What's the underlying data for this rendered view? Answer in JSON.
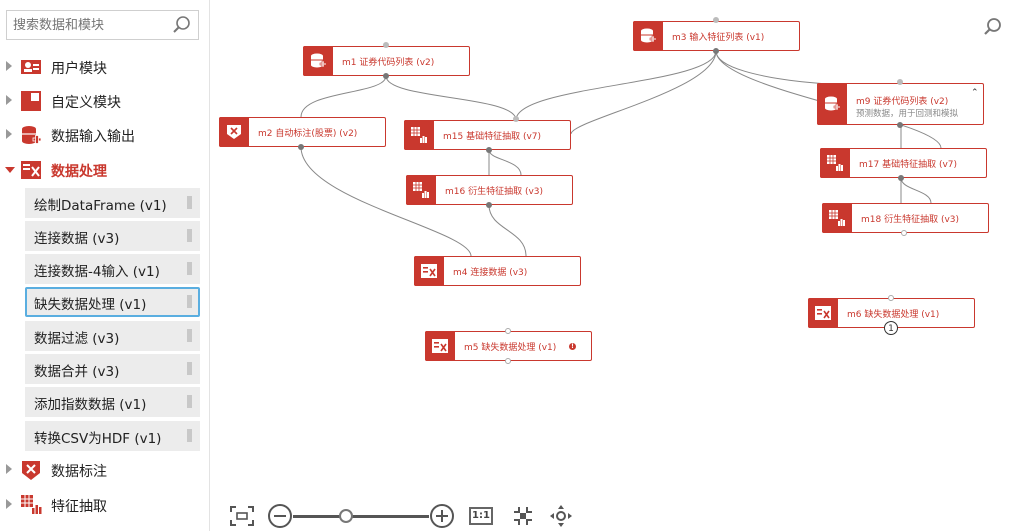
{
  "search": {
    "placeholder": "搜索数据和模块"
  },
  "sidebar": {
    "categories": [
      {
        "label": "用户模块",
        "icon": "user-module-icon"
      },
      {
        "label": "自定义模块",
        "icon": "custom-module-icon"
      },
      {
        "label": "数据输入输出",
        "icon": "data-io-icon"
      },
      {
        "label": "数据处理",
        "icon": "data-processing-icon"
      },
      {
        "label": "数据标注",
        "icon": "data-label-icon"
      },
      {
        "label": "特征抽取",
        "icon": "feature-extract-icon"
      }
    ],
    "sub_items": [
      {
        "label": "绘制DataFrame (v1)"
      },
      {
        "label": "连接数据 (v3)"
      },
      {
        "label": "连接数据-4输入 (v1)"
      },
      {
        "label": "缺失数据处理 (v1)"
      },
      {
        "label": "数据过滤 (v3)"
      },
      {
        "label": "数据合并 (v3)"
      },
      {
        "label": "添加指数数据 (v1)"
      },
      {
        "label": "转换CSV为HDF (v1)"
      }
    ]
  },
  "nodes": {
    "m1": {
      "label": "m1 证券代码列表 (v2)"
    },
    "m3": {
      "label": "m3 输入特征列表 (v1)"
    },
    "m9": {
      "label": "m9 证券代码列表 (v2)",
      "subtitle": "预测数据，用于回测和模拟"
    },
    "m2": {
      "label": "m2 自动标注(股票) (v2)"
    },
    "m15": {
      "label": "m15 基础特征抽取 (v7)"
    },
    "m17": {
      "label": "m17 基础特征抽取 (v7)"
    },
    "m16": {
      "label": "m16 衍生特征抽取 (v3)"
    },
    "m18": {
      "label": "m18 衍生特征抽取 (v3)"
    },
    "m4": {
      "label": "m4 连接数据 (v3)"
    },
    "m6": {
      "label": "m6 缺失数据处理 (v1)",
      "badge": "1"
    },
    "m5": {
      "label": "m5 缺失数据处理 (v1)",
      "warning": "!"
    }
  },
  "toolbar": {
    "zoom_reset": "1:1"
  },
  "colors": {
    "accent": "#c9382e",
    "selected_border": "#5aaee0"
  }
}
